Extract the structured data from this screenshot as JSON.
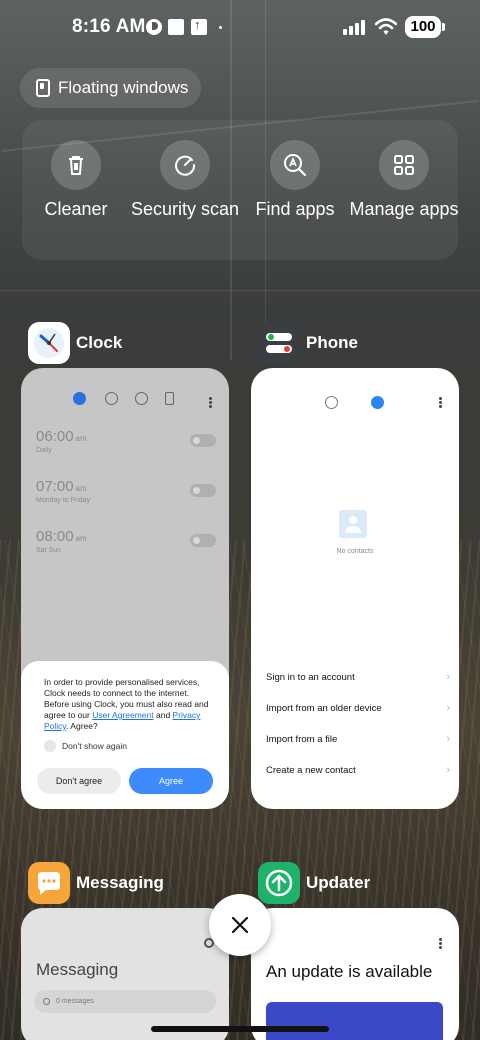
{
  "status_bar": {
    "time": "8:16 AM",
    "battery": "100"
  },
  "floating_windows": {
    "label": "Floating windows"
  },
  "tools": [
    {
      "label": "Cleaner",
      "icon": "trash-icon"
    },
    {
      "label": "Security scan",
      "icon": "security-scan-icon"
    },
    {
      "label": "Find apps",
      "icon": "find-apps-icon"
    },
    {
      "label": "Manage apps",
      "icon": "grid-icon"
    }
  ],
  "apps": {
    "clock": {
      "name": "Clock",
      "alarms": [
        {
          "time": "06:00",
          "ampm": "am",
          "repeat": "Daily"
        },
        {
          "time": "07:00",
          "ampm": "am",
          "repeat": "Monday to Friday"
        },
        {
          "time": "08:00",
          "ampm": "am",
          "repeat": "Sat Sun"
        }
      ],
      "dialog": {
        "text_before": "In order to provide personalised services, Clock needs to connect to the internet. Before using Clock, you must also read and agree to our ",
        "link_user_agreement": "User Agreement",
        "text_and": " and ",
        "link_privacy": "Privacy Policy",
        "text_after": ". Agree?",
        "checkbox_label": "Don't show again",
        "decline_label": "Don't agree",
        "accept_label": "Agree"
      }
    },
    "phone": {
      "name": "Phone",
      "empty_text": "No contacts",
      "actions": [
        "Sign in to an account",
        "Import from an older device",
        "Import from a file",
        "Create a new contact"
      ]
    },
    "messaging": {
      "name": "Messaging",
      "title": "Messaging",
      "search_placeholder": "0 messages"
    },
    "updater": {
      "name": "Updater",
      "title": "An update is available"
    }
  },
  "colors": {
    "accent_blue": "#3d8bfd",
    "updater_green": "#1fb36a",
    "messaging_orange": "#f7a53b"
  }
}
